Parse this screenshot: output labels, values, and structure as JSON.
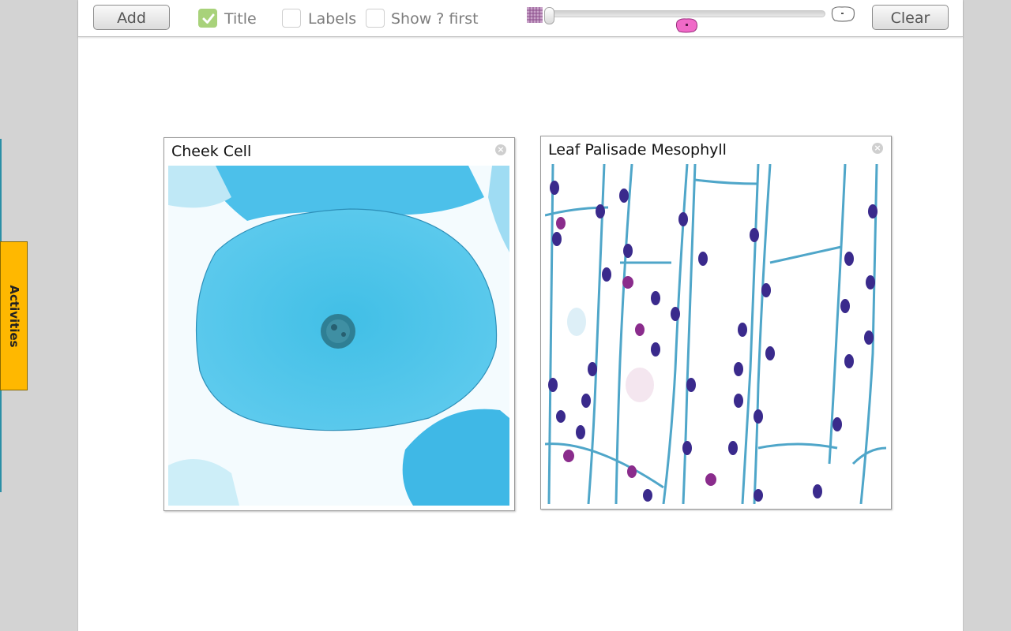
{
  "toolbar": {
    "add_label": "Add",
    "title_checkbox": {
      "label": "Title",
      "checked": true
    },
    "labels_checkbox": {
      "label": "Labels",
      "checked": false
    },
    "show_first_checkbox": {
      "label": "Show ? first",
      "checked": false
    },
    "zoom_slider": {
      "value": 0.0,
      "left_icon": "cell-grid-icon",
      "right_icon": "single-cell-icon",
      "marker_icon": "pink-cell-icon"
    },
    "clear_label": "Clear"
  },
  "side": {
    "activities_label": "Activities"
  },
  "cards": [
    {
      "title": "Cheek Cell",
      "image": "cheek-cell-micrograph"
    },
    {
      "title": "Leaf Palisade Mesophyll",
      "image": "leaf-palisade-mesophyll-micrograph"
    }
  ],
  "colors": {
    "accent_check": "#a8d27a",
    "activities_tab": "#ffb800",
    "cheek_stain": "#39b8e0",
    "leaf_stain_dark": "#3a2a8c",
    "leaf_stain_magenta": "#8a2c8c"
  }
}
